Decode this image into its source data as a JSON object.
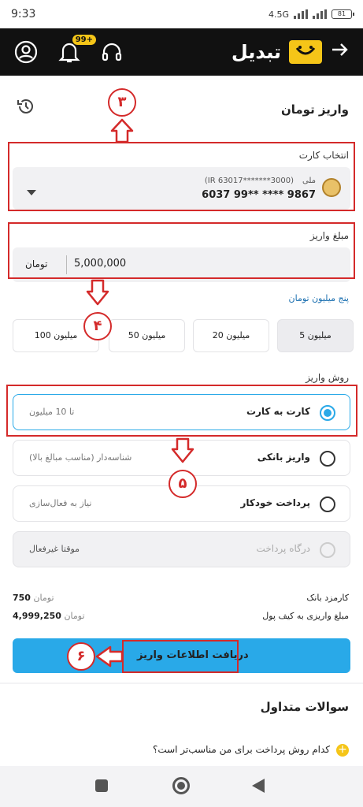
{
  "status": {
    "time": "9:33",
    "network": "4.5G",
    "battery": "81"
  },
  "appbar": {
    "brand": "تبدیل",
    "badge": "99+"
  },
  "page": {
    "title": "واریز تومان"
  },
  "card_select": {
    "label": "انتخاب کارت",
    "bank": "ملی",
    "iban": "(IR 63017*******3000)",
    "number": "6037 99** **** 9867"
  },
  "amount": {
    "label": "مبلغ واریز",
    "value": "5,000,000",
    "unit": "تومان",
    "words": "پنج میلیون تومان"
  },
  "chips": [
    "5 میلیون",
    "20 میلیون",
    "50 میلیون",
    "100 میلیون"
  ],
  "method": {
    "label": "روش واریز",
    "options": [
      {
        "label": "کارت به کارت",
        "note": "تا 10 میلیون"
      },
      {
        "label": "واریز بانکی",
        "note": "شناسه‌دار (مناسب مبالغ بالا)"
      },
      {
        "label": "پرداخت خودکار",
        "note": "نیاز به فعال‌سازی"
      },
      {
        "label": "درگاه پرداخت",
        "note": "موقتا غیرفعال"
      }
    ]
  },
  "fees": {
    "bank_fee_label": "کارمزد بانک",
    "bank_fee_value": "750",
    "bank_fee_unit": "تومان",
    "wallet_label": "مبلغ واریزی به کیف پول",
    "wallet_value": "4,999,250",
    "wallet_unit": "تومان"
  },
  "submit_label": "دریافت اطلاعات واریز",
  "faq": {
    "title": "سوالات متداول",
    "q1": "کدام روش پرداخت برای من مناسب‌تر است؟"
  },
  "annotations": {
    "n3": "۳",
    "n4": "۴",
    "n5": "۵",
    "n6": "۶"
  },
  "colors": {
    "accent": "#29a9e8",
    "brand": "#f5c518",
    "annotation": "#d42a2a"
  }
}
